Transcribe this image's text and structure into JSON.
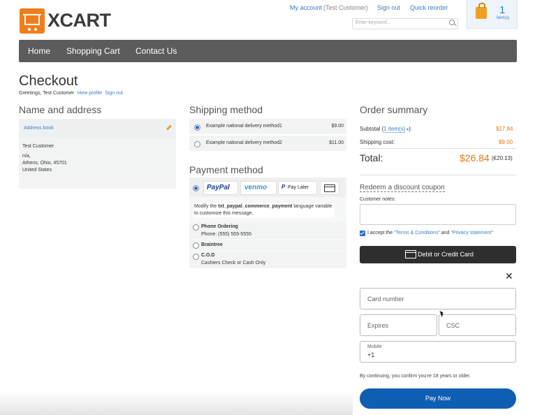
{
  "header": {
    "logo_text": "XCART",
    "links": {
      "my_account": "My account",
      "user": "(Test Customer)",
      "sign_out": "Sign out",
      "quick_reorder": "Quick reorder"
    },
    "search_placeholder": "Enter keyword...",
    "cart": {
      "count": "1",
      "label": "item(s)"
    }
  },
  "nav": {
    "items": [
      "Home",
      "Shopping Cart",
      "Contact Us"
    ]
  },
  "page": {
    "title": "Checkout",
    "greeting": "Greetings, Test Customer",
    "view_profile": "View profile",
    "sign_out": "Sign out"
  },
  "address": {
    "heading": "Name and address",
    "book_label": "Address book",
    "name": "Test Customer",
    "line1": "n/a,",
    "line2": "Athens, Ohio, 45701",
    "country": "United States"
  },
  "shipping": {
    "heading": "Shipping method",
    "options": [
      {
        "label": "Example national delivery method1",
        "price": "$9.00",
        "selected": true
      },
      {
        "label": "Example national delivery method2",
        "price": "$11.00",
        "selected": false
      }
    ]
  },
  "payment": {
    "heading": "Payment method",
    "logos": {
      "paypal": "PayPal",
      "venmo": "venmo",
      "paylater": "Pay Later"
    },
    "modify_pre": "Modify the ",
    "modify_bold": "txt_paypal_commerce_payment",
    "modify_post": " language variable to customize this message.",
    "options": [
      {
        "name": "Phone Ordering",
        "detail": "Phone: (555) 555-5555"
      },
      {
        "name": "Braintree",
        "detail": ""
      },
      {
        "name": "C.O.D",
        "detail": "Cashiers Check or Cash Only"
      }
    ]
  },
  "summary": {
    "heading": "Order summary",
    "subtotal_label": "Subtotal (",
    "subtotal_items": "1 item(s)",
    "subtotal_close": "):",
    "subtotal_value": "$17.84",
    "shipping_label": "Shipping cost:",
    "shipping_value": "$9.00",
    "total_label": "Total:",
    "total_value": "$26.84",
    "total_alt": "(€20.13)",
    "coupon": "Redeem a discount coupon",
    "notes_label": "Customer notes:",
    "accept_pre": "I accept the ",
    "terms": "\"Terms & Conditions\"",
    "accept_and": " and ",
    "privacy": "\"Privacy statement\""
  },
  "card": {
    "button_label": "Debit or Credit Card",
    "close": "✕",
    "card_number": "Card number",
    "expires": "Expires",
    "csc": "CSC",
    "mobile_label": "Mobile",
    "mobile_value": "+1",
    "confirm_text": "By continuing, you confirm you're 18 years or older.",
    "pay_now": "Pay Now"
  }
}
